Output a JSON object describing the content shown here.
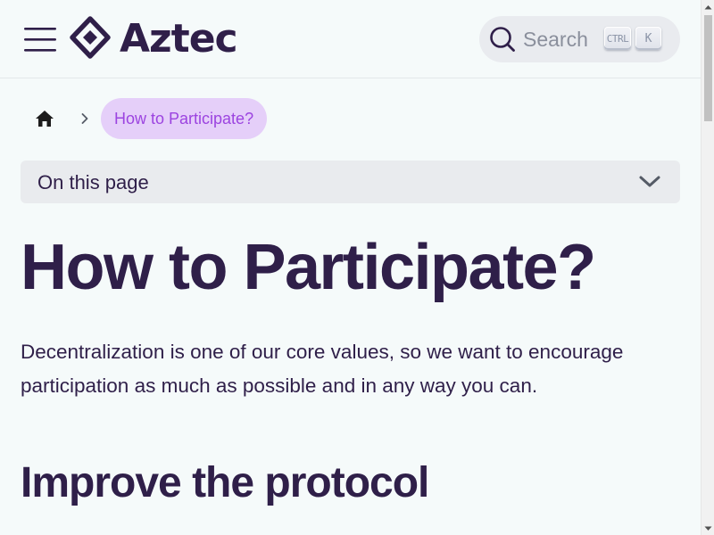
{
  "navbar": {
    "logo_text": "Aztec",
    "search_placeholder": "Search",
    "shortcut_ctrl": "CTRL",
    "shortcut_key": "K"
  },
  "breadcrumb": {
    "current": "How to Participate?"
  },
  "toc": {
    "label": "On this page"
  },
  "content": {
    "title": "How to Participate?",
    "intro_line1": "Decentralization is one of our core values, so we want to encourage",
    "intro_line2": "participation as much as possible and in any way you can.",
    "section_heading": "Improve the protocol"
  },
  "colors": {
    "background": "#f5fafa",
    "text": "#2f1f49",
    "accent": "#9c44e0",
    "accent_bg": "#e5cff9"
  },
  "icons": [
    "hamburger-menu-icon",
    "aztec-diamond-logo",
    "search-icon",
    "home-icon",
    "chevron-right-icon",
    "chevron-down-icon"
  ]
}
